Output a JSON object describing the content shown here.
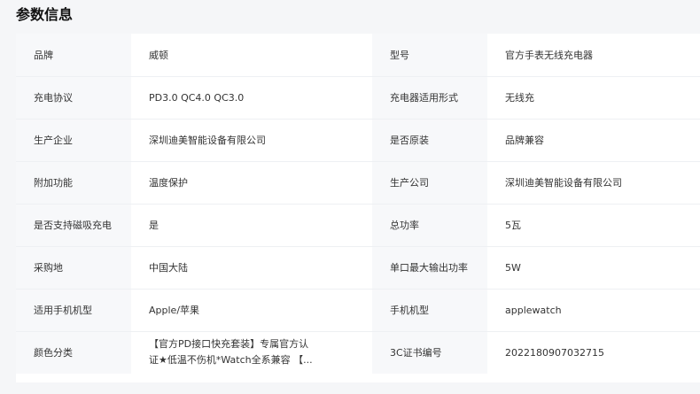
{
  "section": {
    "title": "参数信息"
  },
  "rows": [
    [
      {
        "label": "品牌",
        "value": "威顿"
      },
      {
        "label": "型号",
        "value": "官方手表无线充电器"
      }
    ],
    [
      {
        "label": "充电协议",
        "value": "PD3.0 QC4.0 QC3.0"
      },
      {
        "label": "充电器适用形式",
        "value": "无线充"
      }
    ],
    [
      {
        "label": "生产企业",
        "value": "深圳迪美智能设备有限公司"
      },
      {
        "label": "是否原装",
        "value": "品牌兼容"
      }
    ],
    [
      {
        "label": "附加功能",
        "value": "温度保护"
      },
      {
        "label": "生产公司",
        "value": "深圳迪美智能设备有限公司"
      }
    ],
    [
      {
        "label": "是否支持磁吸充电",
        "value": "是"
      },
      {
        "label": "总功率",
        "value": "5瓦"
      }
    ],
    [
      {
        "label": "采购地",
        "value": "中国大陆"
      },
      {
        "label": "单口最大输出功率",
        "value": "5W"
      }
    ],
    [
      {
        "label": "适用手机机型",
        "value": "Apple/苹果"
      },
      {
        "label": "手机机型",
        "value": "applewatch"
      }
    ],
    [
      {
        "label": "颜色分类",
        "value_line1": "【官方PD接口快充套装】专属官方认",
        "value_line2": "证★低温不伤机*Watch全系兼容 【..."
      },
      {
        "label": "3C证书编号",
        "value": "2022180907032715"
      }
    ]
  ]
}
